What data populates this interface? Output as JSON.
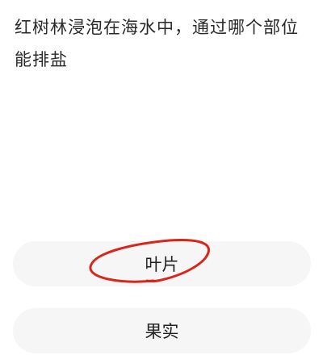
{
  "question": {
    "text": "红树林浸泡在海水中，通过哪个部位能排盐"
  },
  "options": [
    {
      "label": "叶片"
    },
    {
      "label": "果实"
    }
  ],
  "annotation": {
    "icon": "red-circle-mark",
    "color": "#d8261b"
  }
}
